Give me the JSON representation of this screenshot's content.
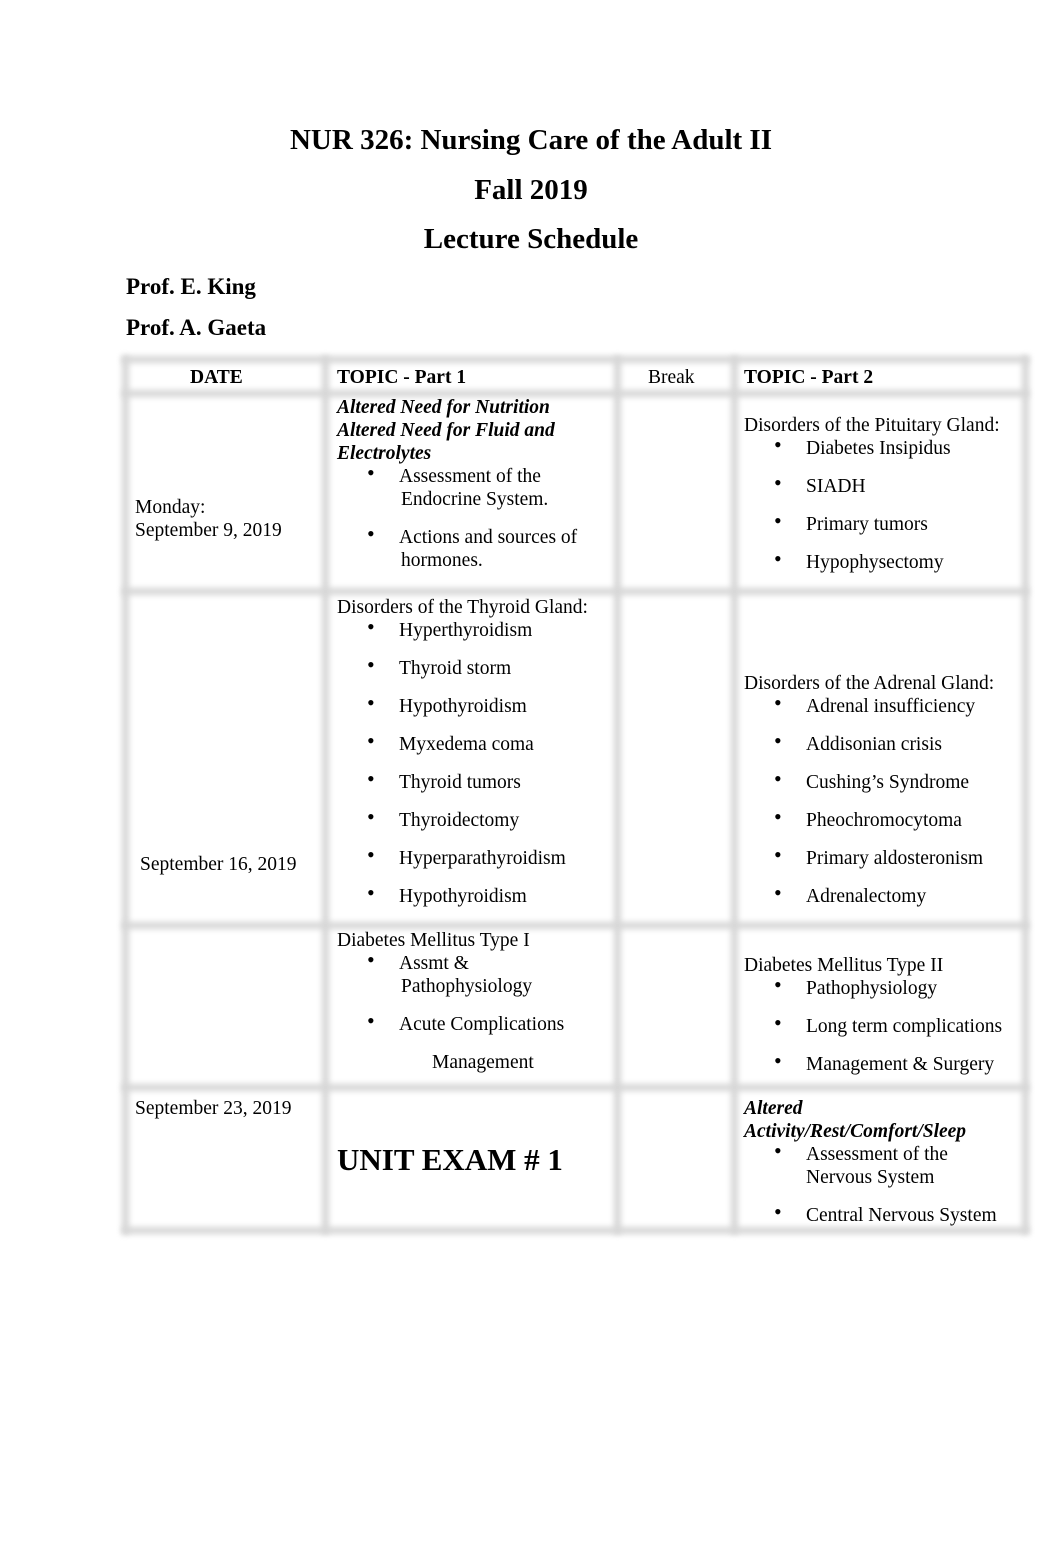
{
  "document": {
    "title_line1": "NUR 326: Nursing Care of the Adult II",
    "title_line2": "Fall 2019",
    "title_line3": "Lecture Schedule",
    "professors": [
      "Prof. E. King",
      "Prof. A. Gaeta"
    ]
  },
  "table": {
    "headers": {
      "date": "DATE",
      "topic1": "TOPIC - Part 1",
      "break": "Break",
      "topic2": "TOPIC - Part 2"
    },
    "rows": [
      {
        "date_line1": "Monday:",
        "date_line2": "September 9, 2019",
        "topic1": {
          "heading_lines": [
            "Altered Need for Nutrition",
            "Altered Need for Fluid and",
            "Electrolytes"
          ],
          "bullets": [
            [
              "Assessment of the",
              "Endocrine System."
            ],
            [
              "Actions and sources of",
              "hormones."
            ]
          ]
        },
        "break": "",
        "topic2": {
          "heading": "Disorders of the Pituitary Gland:",
          "bullets": [
            "Diabetes Insipidus",
            "SIADH",
            "Primary tumors",
            "Hypophysectomy"
          ]
        }
      },
      {
        "date_line1": "September 16, 2019",
        "topic1": {
          "heading": "Disorders of the Thyroid Gland:",
          "bullets": [
            "Hyperthyroidism",
            "Thyroid storm",
            "Hypothyroidism",
            "Myxedema coma",
            "Thyroid tumors",
            "Thyroidectomy",
            "Hyperparathyroidism",
            "Hypothyroidism"
          ]
        },
        "break": "",
        "topic2": {
          "heading": "Disorders of the Adrenal Gland:",
          "bullets": [
            "Adrenal insufficiency",
            "Addisonian crisis",
            "Cushing’s Syndrome",
            "Pheochromocytoma",
            "Primary aldosteronism",
            "Adrenalectomy"
          ]
        }
      },
      {
        "date_line1": "",
        "topic1": {
          "heading": "Diabetes Mellitus Type I",
          "bullets": [
            [
              "Assmt &",
              "Pathophysiology"
            ],
            [
              "Acute Complications"
            ]
          ],
          "trailing": "Management"
        },
        "break": "",
        "topic2": {
          "heading": "Diabetes Mellitus Type II",
          "bullets": [
            "Pathophysiology",
            "Long term complications",
            "Management & Surgery"
          ]
        }
      },
      {
        "date_line1": "September 23, 2019",
        "topic1": {
          "exam": "UNIT EXAM # 1"
        },
        "break": "",
        "topic2": {
          "heading_lines": [
            "Altered",
            "Activity/Rest/Comfort/Sleep"
          ],
          "bullets": [
            [
              "Assessment of the",
              "Nervous System"
            ],
            [
              "Central Nervous System"
            ]
          ]
        }
      }
    ]
  }
}
